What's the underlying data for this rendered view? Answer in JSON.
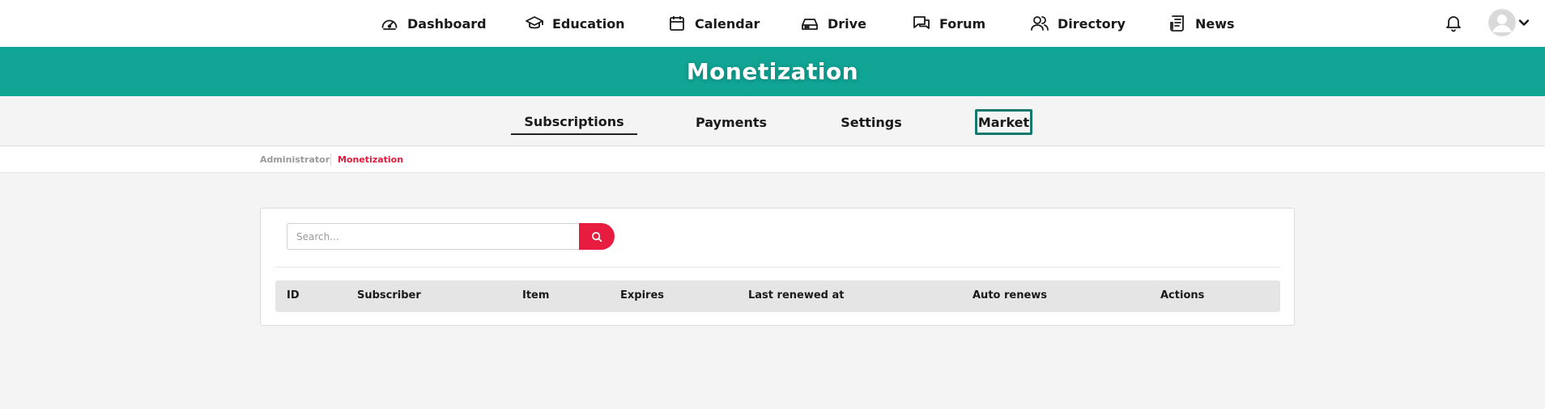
{
  "nav": {
    "items": [
      {
        "label": "Dashboard",
        "icon": "dashboard-icon"
      },
      {
        "label": "Education",
        "icon": "graduation-cap-icon"
      },
      {
        "label": "Calendar",
        "icon": "calendar-icon"
      },
      {
        "label": "Drive",
        "icon": "drive-icon"
      },
      {
        "label": "Forum",
        "icon": "forum-icon"
      },
      {
        "label": "Directory",
        "icon": "users-icon"
      },
      {
        "label": "News",
        "icon": "news-icon"
      }
    ]
  },
  "header": {
    "title": "Monetization"
  },
  "tabs": [
    {
      "label": "Subscriptions",
      "state": "active"
    },
    {
      "label": "Payments",
      "state": "normal"
    },
    {
      "label": "Settings",
      "state": "normal"
    },
    {
      "label": "Market",
      "state": "focused"
    }
  ],
  "breadcrumb": {
    "items": [
      "Administrator",
      "Monetization"
    ]
  },
  "search": {
    "placeholder": "Search...",
    "value": ""
  },
  "table": {
    "columns": [
      "ID",
      "Subscriber",
      "Item",
      "Expires",
      "Last renewed at",
      "Auto renews",
      "Actions"
    ],
    "rows": []
  },
  "colors": {
    "brand": "#10a595",
    "accent": "#e81c3f",
    "focus_border": "#14776c"
  }
}
